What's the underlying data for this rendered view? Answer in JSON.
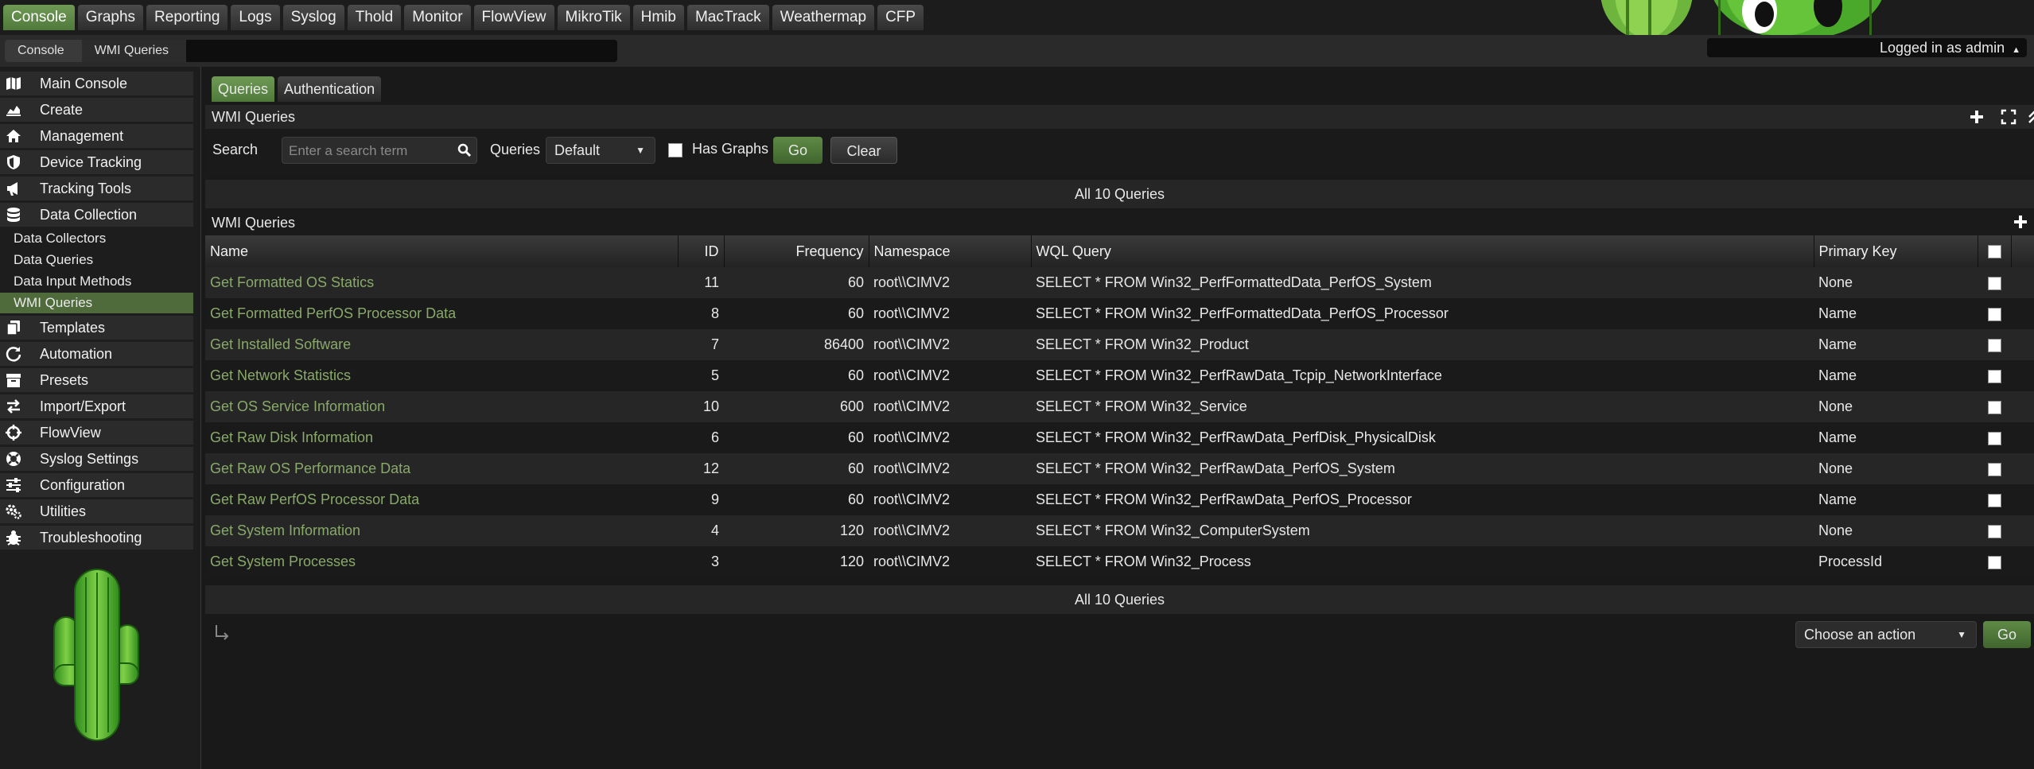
{
  "nav": {
    "tabs": [
      "Console",
      "Graphs",
      "Reporting",
      "Logs",
      "Syslog",
      "Thold",
      "Monitor",
      "FlowView",
      "MikroTik",
      "Hmib",
      "MacTrack",
      "Weathermap",
      "CFP"
    ],
    "active_tab": "Console"
  },
  "breadcrumb": [
    "Console",
    "WMI Queries"
  ],
  "login_status": "Logged in as admin",
  "sidebar": {
    "items": [
      {
        "label": "Main Console",
        "icon": "map-icon"
      },
      {
        "label": "Create",
        "icon": "chart-area-icon"
      },
      {
        "label": "Management",
        "icon": "home-icon"
      },
      {
        "label": "Device Tracking",
        "icon": "shield-icon"
      },
      {
        "label": "Tracking Tools",
        "icon": "bullhorn-icon"
      },
      {
        "label": "Data Collection",
        "icon": "database-icon"
      }
    ],
    "sub_items": [
      "Data Collectors",
      "Data Queries",
      "Data Input Methods",
      "WMI Queries"
    ],
    "active_sub": "WMI Queries",
    "items_after": [
      {
        "label": "Templates",
        "icon": "copy-icon"
      },
      {
        "label": "Automation",
        "icon": "refresh-icon"
      },
      {
        "label": "Presets",
        "icon": "archive-icon"
      },
      {
        "label": "Import/Export",
        "icon": "exchange-icon"
      },
      {
        "label": "FlowView",
        "icon": "crosshair-icon"
      },
      {
        "label": "Syslog Settings",
        "icon": "lifebuoy-icon"
      },
      {
        "label": "Configuration",
        "icon": "sliders-icon"
      },
      {
        "label": "Utilities",
        "icon": "cogs-icon"
      },
      {
        "label": "Troubleshooting",
        "icon": "bug-icon"
      }
    ]
  },
  "subtabs": [
    "Queries",
    "Authentication"
  ],
  "active_subtab": "Queries",
  "filter": {
    "title": "WMI Queries",
    "search_label": "Search",
    "search_placeholder": "Enter a search term",
    "search_value": "",
    "queries_label": "Queries",
    "queries_value": "Default",
    "has_graphs_label": "Has Graphs",
    "has_graphs_checked": false,
    "go_label": "Go",
    "clear_label": "Clear"
  },
  "nav_text": "All 10 Queries",
  "table": {
    "title": "WMI Queries",
    "columns": [
      "Name",
      "ID",
      "Frequency",
      "Namespace",
      "WQL Query",
      "Primary Key"
    ],
    "rows": [
      {
        "name": "Get Formatted OS Statics",
        "id": "11",
        "frequency": "60",
        "namespace": "root\\\\CIMV2",
        "query": "SELECT * FROM Win32_PerfFormattedData_PerfOS_System",
        "key": "None"
      },
      {
        "name": "Get Formatted PerfOS Processor Data",
        "id": "8",
        "frequency": "60",
        "namespace": "root\\\\CIMV2",
        "query": "SELECT * FROM Win32_PerfFormattedData_PerfOS_Processor",
        "key": "Name"
      },
      {
        "name": "Get Installed Software",
        "id": "7",
        "frequency": "86400",
        "namespace": "root\\\\CIMV2",
        "query": "SELECT * FROM Win32_Product",
        "key": "Name"
      },
      {
        "name": "Get Network Statistics",
        "id": "5",
        "frequency": "60",
        "namespace": "root\\\\CIMV2",
        "query": "SELECT * FROM Win32_PerfRawData_Tcpip_NetworkInterface",
        "key": "Name"
      },
      {
        "name": "Get OS Service Information",
        "id": "10",
        "frequency": "600",
        "namespace": "root\\\\CIMV2",
        "query": "SELECT * FROM Win32_Service",
        "key": "None"
      },
      {
        "name": "Get Raw Disk Information",
        "id": "6",
        "frequency": "60",
        "namespace": "root\\\\CIMV2",
        "query": "SELECT * FROM Win32_PerfRawData_PerfDisk_PhysicalDisk",
        "key": "Name"
      },
      {
        "name": "Get Raw OS Performance Data",
        "id": "12",
        "frequency": "60",
        "namespace": "root\\\\CIMV2",
        "query": "SELECT * FROM Win32_PerfRawData_PerfOS_System",
        "key": "None"
      },
      {
        "name": "Get Raw PerfOS Processor Data",
        "id": "9",
        "frequency": "60",
        "namespace": "root\\\\CIMV2",
        "query": "SELECT * FROM Win32_PerfRawData_PerfOS_Processor",
        "key": "Name"
      },
      {
        "name": "Get System Information",
        "id": "4",
        "frequency": "120",
        "namespace": "root\\\\CIMV2",
        "query": "SELECT * FROM Win32_ComputerSystem",
        "key": "None"
      },
      {
        "name": "Get System Processes",
        "id": "3",
        "frequency": "120",
        "namespace": "root\\\\CIMV2",
        "query": "SELECT * FROM Win32_Process",
        "key": "ProcessId"
      }
    ]
  },
  "action": {
    "placeholder": "Choose an action",
    "go_label": "Go"
  },
  "colors": {
    "accent_green": "#5e8a45",
    "link_green": "#89a96a",
    "background": "#191919"
  }
}
